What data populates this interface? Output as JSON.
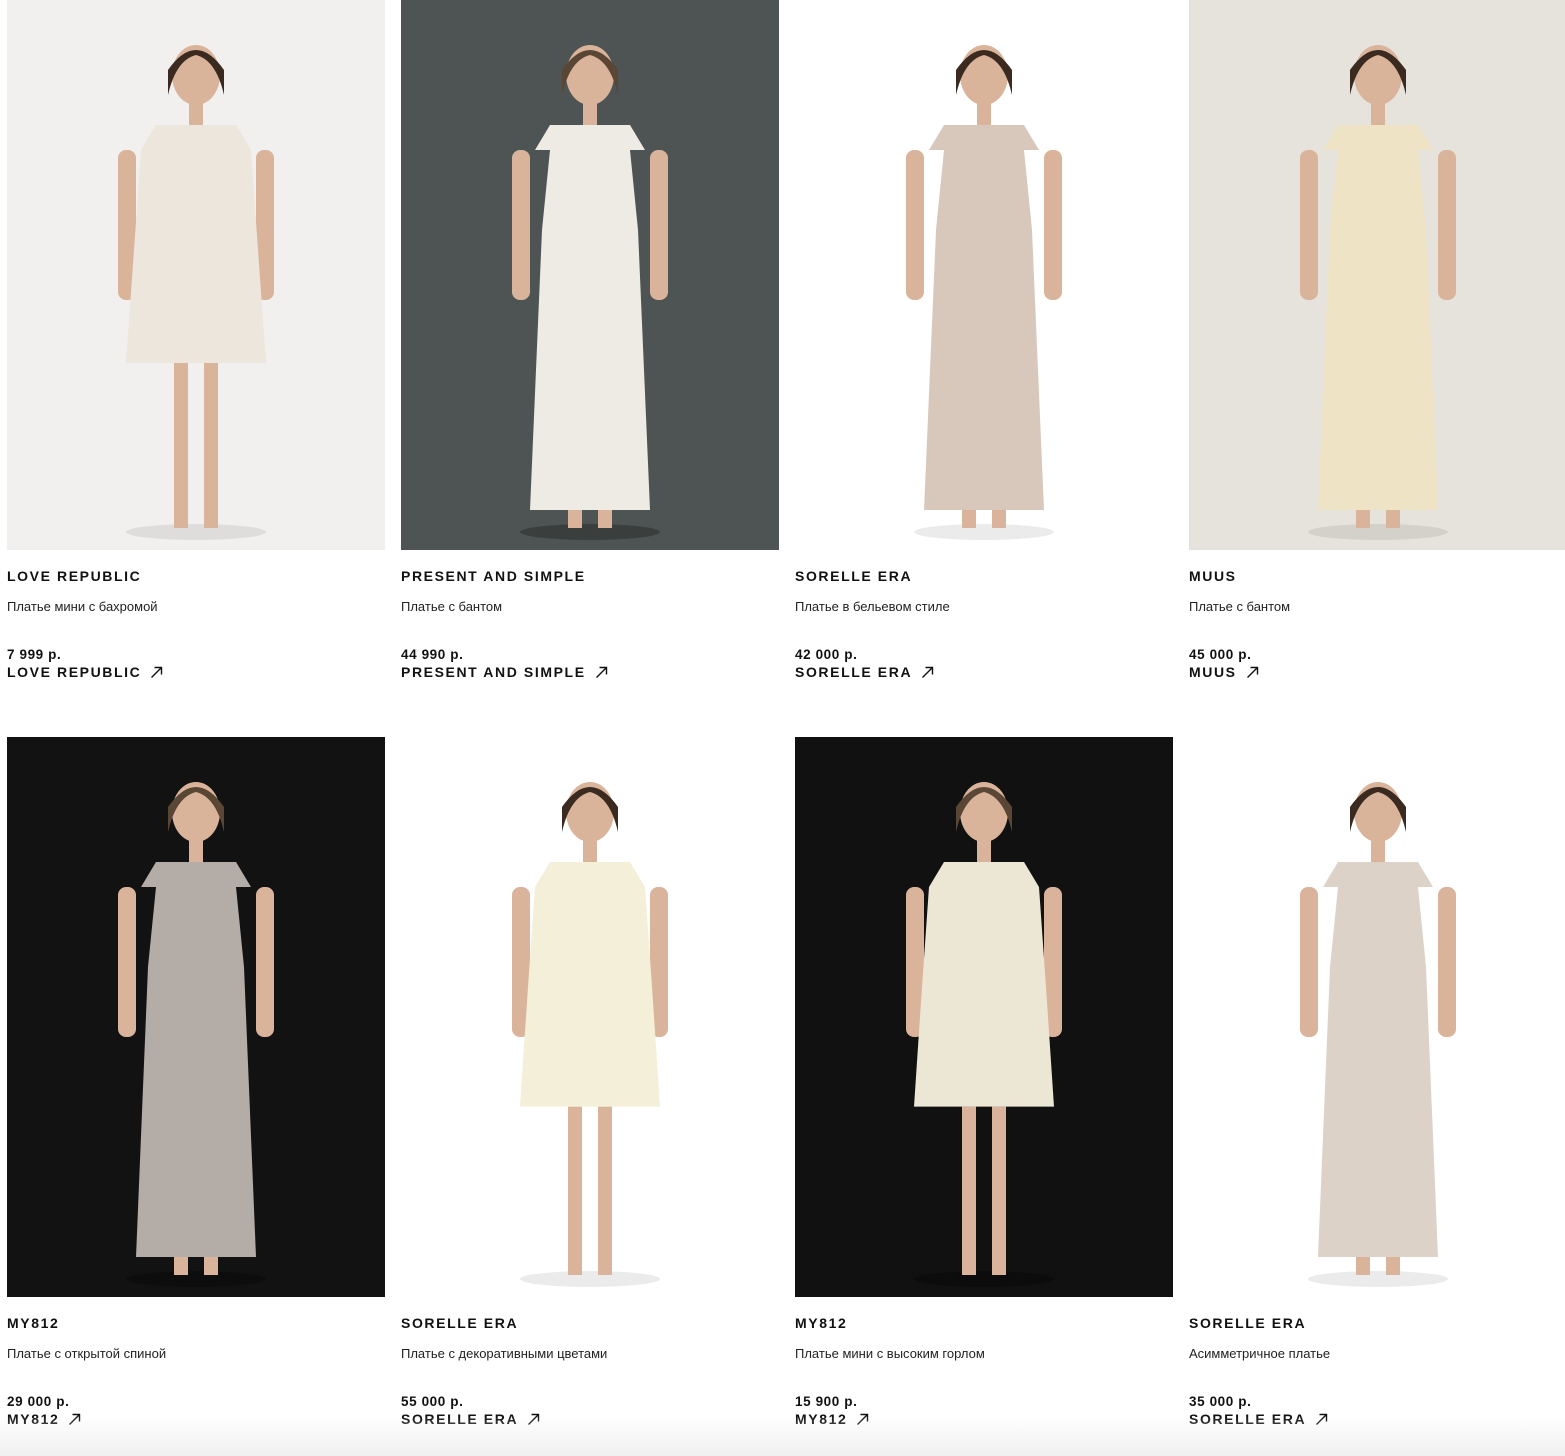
{
  "products": [
    {
      "brand": "LOVE REPUBLIC",
      "title": "Платье мини с бахромой",
      "price": "7 999 р.",
      "shop_link": "LOVE REPUBLIC",
      "image_bg": "#f1f0ee",
      "dress_color": "#ece6dc"
    },
    {
      "brand": "PRESENT AND SIMPLE",
      "title": "Платье с бантом",
      "price": "44 990 р.",
      "shop_link": "PRESENT AND SIMPLE",
      "image_bg": "#4e5453",
      "dress_color": "#eeebe4"
    },
    {
      "brand": "SORELLE ERA",
      "title": "Платье в бельевом стиле",
      "price": "42 000 р.",
      "shop_link": "SORELLE ERA",
      "image_bg": "#ffffff",
      "dress_color": "#d8c8bc"
    },
    {
      "brand": "MUUS",
      "title": "Платье с бантом",
      "price": "45 000 р.",
      "shop_link": "MUUS",
      "image_bg": "#e6e3dc",
      "dress_color": "#efe3c6"
    },
    {
      "brand": "MY812",
      "title": "Платье с открытой спиной",
      "price": "29 000 р.",
      "shop_link": "MY812",
      "image_bg": "#121212",
      "dress_color": "#b4aca6"
    },
    {
      "brand": "SORELLE ERA",
      "title": "Платье с декоративными цветами",
      "price": "55 000 р.",
      "shop_link": "SORELLE ERA",
      "image_bg": "#ffffff",
      "dress_color": "#f4efd8"
    },
    {
      "brand": "MY812",
      "title": "Платье мини с высоким горлом",
      "price": "15 900 р.",
      "shop_link": "MY812",
      "image_bg": "#111111",
      "dress_color": "#ece6d4"
    },
    {
      "brand": "SORELLE ERA",
      "title": "Асимметричное платье",
      "price": "35 000 р.",
      "shop_link": "SORELLE ERA",
      "image_bg": "#ffffff",
      "dress_color": "#dcd2c8"
    }
  ]
}
